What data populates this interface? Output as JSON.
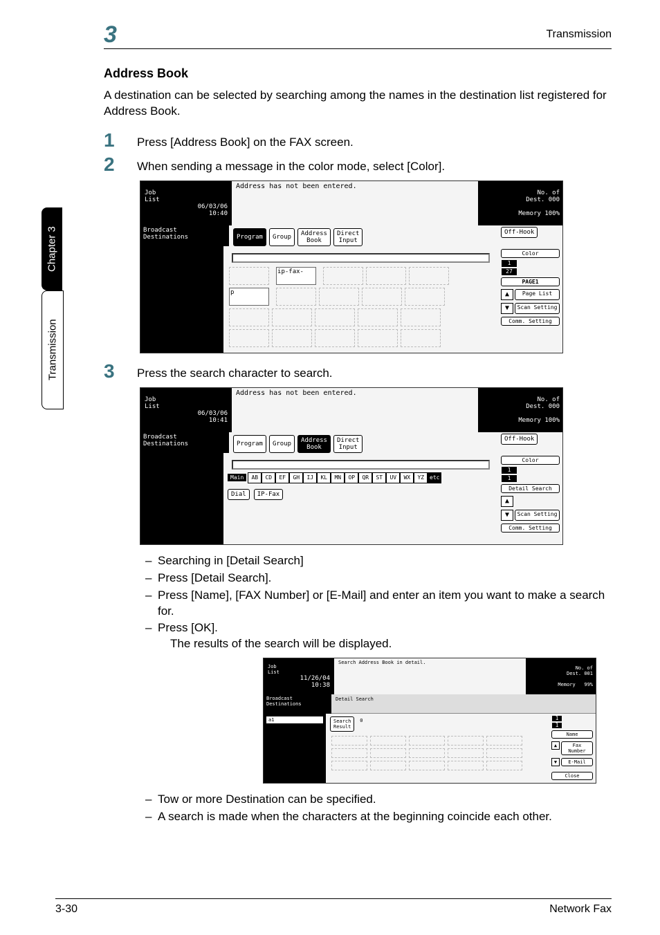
{
  "header": {
    "chapter_numeral": "3",
    "section_title": "Transmission"
  },
  "side": {
    "chapter": "Chapter 3",
    "section": "Transmission"
  },
  "heading": "Address Book",
  "intro": "A destination can be selected by searching among the names in the destination list registered for Address Book.",
  "steps": {
    "s1_num": "1",
    "s1_txt": "Press [Address Book] on the FAX screen.",
    "s2_num": "2",
    "s2_txt": "When sending a message in the color mode, select [Color].",
    "s3_num": "3",
    "s3_txt": "Press the search character to search."
  },
  "screen_common": {
    "job_list": "Job\nList",
    "broadcast": "Broadcast\nDestinations",
    "addr_not_entered": "Address has not been entered.",
    "no_of_dest": "No. of\nDest.",
    "dest_count": "000",
    "memory": "Memory 100%",
    "btn_program": "Program",
    "btn_group": "Group",
    "btn_addrbook": "Address\nBook",
    "btn_direct": "Direct\nInput",
    "btn_offhook": "Off-Hook"
  },
  "screen1": {
    "datetime": "06/03/06\n10:40",
    "cell1": "ip-fax-",
    "cell2": "p",
    "pager_top": "1",
    "pager_bottom": "27",
    "side": {
      "color": "Color",
      "page1": "PAGE1",
      "pagelist": "Page\nList",
      "scan": "Scan\nSetting",
      "comm": "Comm.\nSetting"
    }
  },
  "screen2": {
    "datetime": "06/03/06\n10:41",
    "main_chip": "Main",
    "alpha": [
      "AB",
      "CD",
      "EF",
      "GH",
      "IJ",
      "KL",
      "MN",
      "OP",
      "QR",
      "ST",
      "UV",
      "WX",
      "YZ",
      "etc"
    ],
    "btn_dial": "Dial",
    "btn_ipfax": "IP-Fax",
    "pager_top": "1",
    "pager_bottom": "1",
    "side": {
      "color": "Color",
      "detail": "Detail\nSearch",
      "scan": "Scan\nSetting",
      "comm": "Comm.\nSetting"
    }
  },
  "bullets1": {
    "b1": "Searching in [Detail Search]",
    "b2": "Press [Detail Search].",
    "b3": "Press [Name], [FAX Number] or [E-Mail] and enter an item you want to make a search for.",
    "b4": "Press [OK].",
    "b4_sub": "The results of the search will be displayed."
  },
  "screen3": {
    "datetime": "11/26/04\n10:38",
    "title": "Search Address Book in detail.",
    "no_of_dest": "No. of\nDest.",
    "dest_count": "001",
    "memory": "Memory   99%",
    "detail_search": "Detail Search",
    "bcast": "Broadcast\nDestinations",
    "a1": "a1",
    "search_result": "Search\nResult",
    "result_count": "0",
    "pager_top": "1",
    "pager_bottom": "1",
    "side_name": "Name",
    "side_fax": "Fax\nNumber",
    "side_email": "E-Mail",
    "close": "Close"
  },
  "bullets2": {
    "b1": "Tow or more Destination can be specified.",
    "b2": "A search is made when the characters at the beginning coincide each other."
  },
  "footer": {
    "page": "3-30",
    "book": "Network Fax"
  }
}
